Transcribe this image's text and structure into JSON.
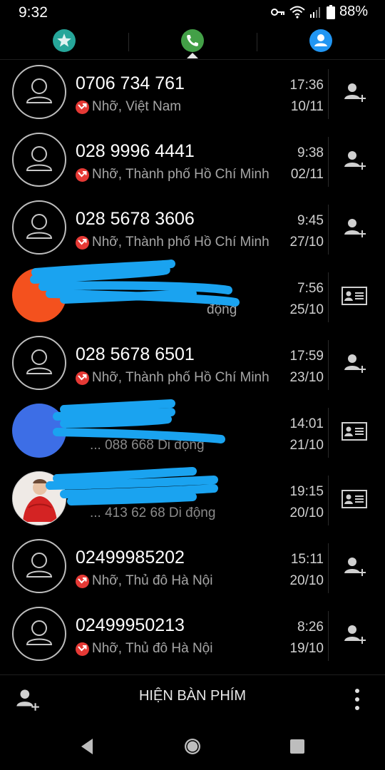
{
  "status_bar": {
    "time": "9:32",
    "battery": "88%",
    "icons": [
      "key-icon",
      "wifi-icon",
      "signal-icon",
      "battery-icon"
    ]
  },
  "tabs": [
    {
      "name": "favorites",
      "icon": "star-icon",
      "color": "#26a69a"
    },
    {
      "name": "recents",
      "icon": "phone-icon",
      "color": "#43a047",
      "selected": true
    },
    {
      "name": "contacts",
      "icon": "person-icon",
      "color": "#2196f3"
    }
  ],
  "calls": [
    {
      "name": "0706 734 761",
      "sub": "Nhỡ, Việt Nam",
      "time": "17:36",
      "date": "10/11",
      "avatar": "default",
      "action": "add-contact-icon"
    },
    {
      "name": "028 9996 4441",
      "sub": "Nhỡ, Thành phố Hồ Chí Minh",
      "time": "9:38",
      "date": "02/11",
      "avatar": "default",
      "action": "add-contact-icon"
    },
    {
      "name": "028 5678 3606",
      "sub": "Nhỡ, Thành phố Hồ Chí Minh",
      "time": "9:45",
      "date": "27/10",
      "avatar": "default",
      "action": "add-contact-icon"
    },
    {
      "name": "",
      "sub": "động",
      "time": "7:56",
      "date": "25/10",
      "avatar": "orange",
      "action": "contact-card-icon",
      "redacted": true
    },
    {
      "name": "028 5678 6501",
      "sub": "Nhỡ, Thành phố Hồ Chí Minh",
      "time": "17:59",
      "date": "23/10",
      "avatar": "default",
      "action": "add-contact-icon"
    },
    {
      "name": "",
      "sub": "... 088 668 Di động",
      "time": "14:01",
      "date": "21/10",
      "avatar": "blue",
      "action": "contact-card-icon",
      "redacted": true
    },
    {
      "name": "",
      "sub": "... 413 62 68 Di động",
      "time": "19:15",
      "date": "20/10",
      "avatar": "photo",
      "action": "contact-card-icon",
      "redacted": true
    },
    {
      "name": "02499985202",
      "sub": "Nhỡ, Thủ đô Hà Nội",
      "time": "15:11",
      "date": "20/10",
      "avatar": "default",
      "action": "add-contact-icon"
    },
    {
      "name": "02499950213",
      "sub": "Nhỡ, Thủ đô Hà Nội",
      "time": "8:26",
      "date": "19/10",
      "avatar": "default",
      "action": "add-contact-icon"
    }
  ],
  "bottom_bar": {
    "show_keypad_label": "HIỆN BÀN PHÍM",
    "left_icon": "add-contact-icon",
    "right_icon": "more-vert-icon"
  },
  "nav_bar": [
    "back-icon",
    "home-icon",
    "recents-icon"
  ],
  "colors": {
    "missed": "#e53935",
    "redaction": "#1aa3f0"
  }
}
